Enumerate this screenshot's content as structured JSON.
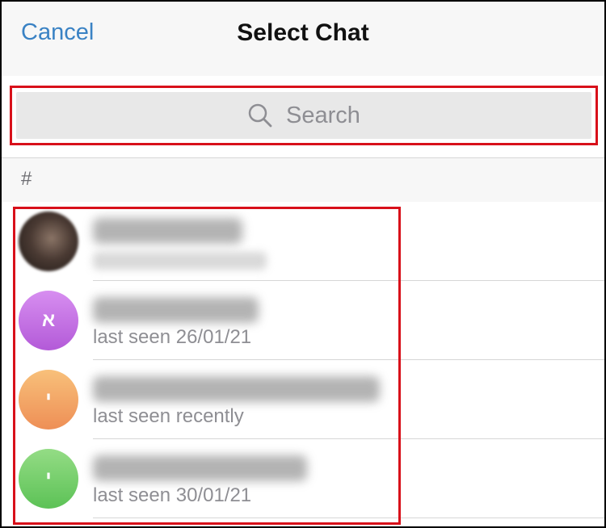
{
  "header": {
    "cancel_label": "Cancel",
    "title": "Select Chat"
  },
  "search": {
    "placeholder": "Search",
    "icon": "search-icon"
  },
  "section": {
    "label": "#"
  },
  "chats": [
    {
      "avatar_initial": "",
      "avatar_type": "photo",
      "status": ""
    },
    {
      "avatar_initial": "א",
      "avatar_color": "#c468e3",
      "status": "last seen 26/01/21"
    },
    {
      "avatar_initial": "י",
      "avatar_color": "#f3a466",
      "status": "last seen recently"
    },
    {
      "avatar_initial": "י",
      "avatar_color": "#77cf6e",
      "status": "last seen 30/01/21"
    }
  ],
  "colors": {
    "accent": "#3a82c4",
    "highlight": "#d8101a"
  }
}
